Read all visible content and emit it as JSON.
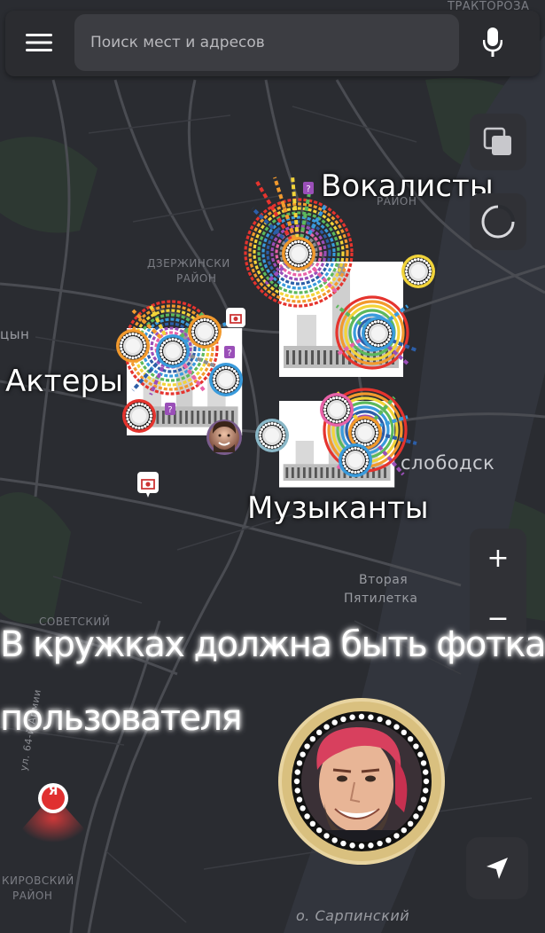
{
  "search": {
    "placeholder": "Поиск мест и адресов"
  },
  "icons": {
    "menu": "hamburger-menu-icon",
    "mic": "microphone-icon",
    "layers": "layers-icon",
    "location": "location-arrow-icon",
    "yandex": "yandex-pin-icon"
  },
  "categories": {
    "vocalists": "Вокалисты",
    "actors": "Актеры",
    "musicians": "Музыканты"
  },
  "map_labels": {
    "traktorozavod": "ТРАКТОРОЗА",
    "dzerzhinsky_1": "ДЗЕРЖИНСКИ",
    "dzerzhinsky_2": "РАЙОН",
    "rayon_top": "РАЙОН",
    "sovetsky": "СОВЕТСКИЙ",
    "kirovsky_1": "КИРОВСКИЙ",
    "kirovsky_2": "РАЙОН",
    "tsyn": "цын",
    "slobodsk": "слободск",
    "vtoraya_1": "Вторая",
    "vtoraya_2": "Пятилетка",
    "sarpinsky": "о. Сарпинский",
    "street": "ул. 64-й Армии",
    "yandex_letter": "Я"
  },
  "zoom": {
    "plus": "+",
    "minus": "−"
  },
  "caption": {
    "line1": "В кружках должна быть фотка",
    "line2": "пользователя"
  },
  "colors": {
    "bg": "#2a2c31",
    "road": "#4a4c52",
    "water": "#3a3d45",
    "park": "#2e3a33",
    "ring": [
      "#e5342e",
      "#f29a2e",
      "#f2d43a",
      "#5cb85c",
      "#3a9bdc",
      "#2c5ea8",
      "#9a4fb8",
      "#e862a8",
      "#8a8d92"
    ]
  }
}
